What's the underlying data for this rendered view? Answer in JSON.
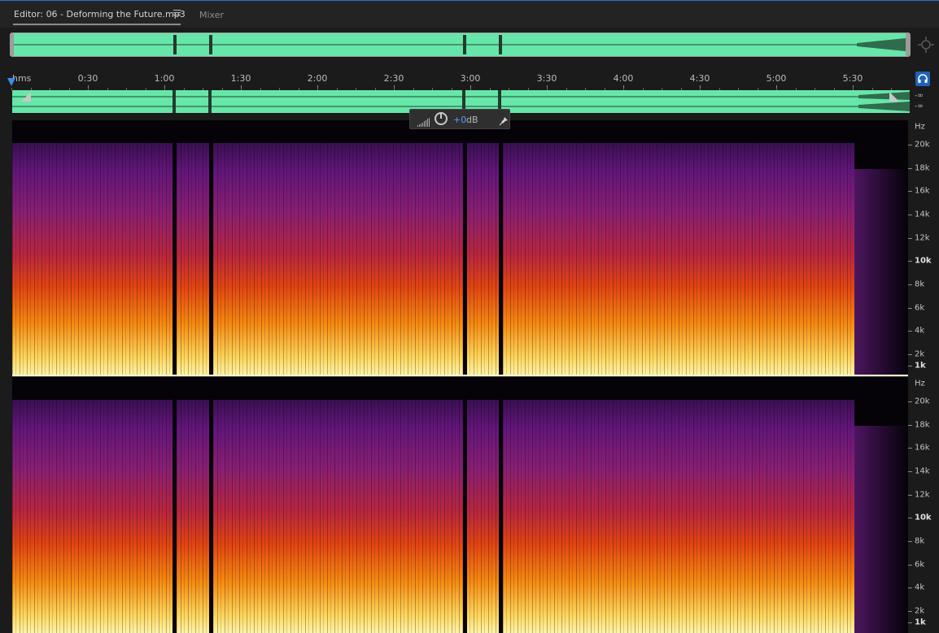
{
  "tabs": {
    "editor_label": "Editor: 06 - Deforming the Future.mp3",
    "mixer_label": "Mixer"
  },
  "ruler": {
    "unit_label": "hms",
    "ticks": [
      "0:30",
      "1:00",
      "1:30",
      "2:00",
      "2:30",
      "3:00",
      "3:30",
      "4:00",
      "4:30",
      "5:00",
      "5:30"
    ]
  },
  "strip": {
    "db_top": "-∞",
    "db_bottom": "-∞"
  },
  "hud": {
    "value": "+0",
    "unit": "dB"
  },
  "freq_axis": {
    "unit": "Hz",
    "labels": [
      "20k",
      "18k",
      "16k",
      "14k",
      "12k",
      "10k",
      "8k",
      "6k",
      "4k",
      "2k",
      "1k"
    ]
  },
  "colors": {
    "waveform": "#66e6a8",
    "accent": "#2d6fd0",
    "hud_value": "#4c9eff"
  },
  "icons": {
    "tab_menu": "hamburger-icon",
    "zoom_nav": "zoom-navigator-icon",
    "headphones": "headphones-icon",
    "level": "level-meter-icon",
    "knob": "volume-knob-icon",
    "pin": "pin-icon"
  }
}
